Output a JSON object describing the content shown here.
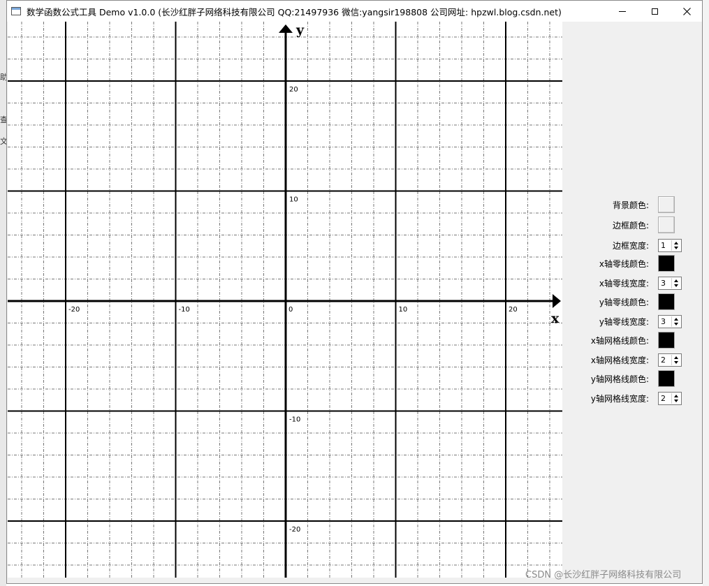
{
  "window": {
    "title": "数学函数公式工具 Demo v1.0.0 (长沙红胖子网络科技有限公司 QQ:21497936 微信:yangsir198808 公司网址: hpzwl.blog.csdn.net)",
    "icons": {
      "minimize": "minimize-icon",
      "maximize": "maximize-icon",
      "close": "close-icon"
    }
  },
  "background": {
    "fragments": [
      "助",
      "查",
      "文"
    ]
  },
  "chart_data": {
    "type": "line",
    "xlabel": "x",
    "ylabel": "y",
    "xlim": [
      -25,
      25
    ],
    "ylim": [
      -25,
      25
    ],
    "x_ticks": [
      -20,
      -10,
      0,
      10,
      20
    ],
    "y_ticks": [
      -20,
      -10,
      10,
      20
    ],
    "major_grid_step": 10,
    "minor_grid_step": 2,
    "grid": true,
    "series": []
  },
  "settings": [
    {
      "label": "背景颜色:",
      "type": "color",
      "value": "#f0f0f0"
    },
    {
      "label": "边框颜色:",
      "type": "color",
      "value": "#f0f0f0"
    },
    {
      "label": "边框宽度:",
      "type": "spin",
      "value": "1"
    },
    {
      "label": "x轴零线颜色:",
      "type": "color",
      "value": "#000000"
    },
    {
      "label": "x轴零线宽度:",
      "type": "spin",
      "value": "3"
    },
    {
      "label": "y轴零线颜色:",
      "type": "color",
      "value": "#000000"
    },
    {
      "label": "y轴零线宽度:",
      "type": "spin",
      "value": "3"
    },
    {
      "label": "x轴网格线颜色:",
      "type": "color",
      "value": "#000000"
    },
    {
      "label": "x轴网格线宽度:",
      "type": "spin",
      "value": "2"
    },
    {
      "label": "y轴网格线颜色:",
      "type": "color",
      "value": "#000000"
    },
    {
      "label": "y轴网格线宽度:",
      "type": "spin",
      "value": "2"
    }
  ],
  "watermark": {
    "text": "CSDN @长沙红胖子网络科技有限公司"
  }
}
